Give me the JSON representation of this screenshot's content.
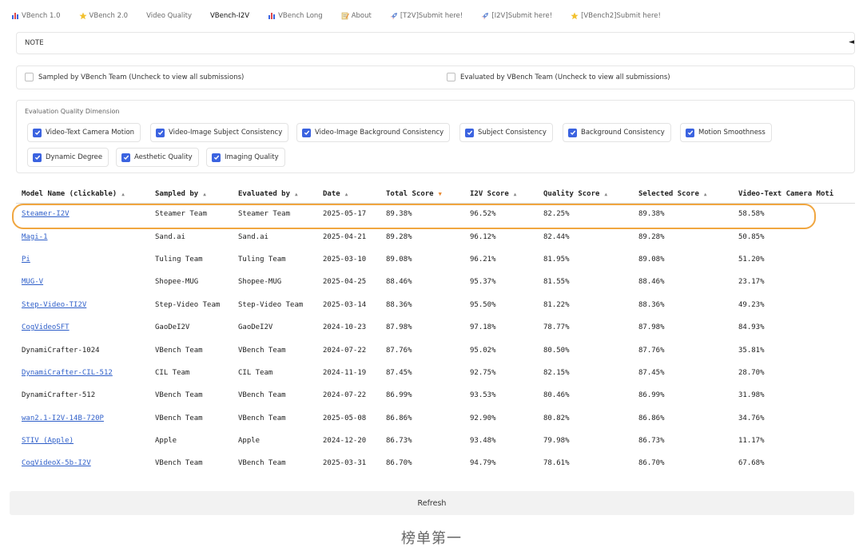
{
  "tabs": [
    {
      "icon": "bar-chart-icon",
      "label": "VBench 1.0"
    },
    {
      "icon": "star-icon",
      "label": "VBench 2.0"
    },
    {
      "icon": "",
      "label": "Video Quality"
    },
    {
      "icon": "",
      "label": "VBench-I2V"
    },
    {
      "icon": "bar-chart-icon",
      "label": "VBench Long"
    },
    {
      "icon": "memo-icon",
      "label": "About"
    },
    {
      "icon": "rocket-icon",
      "label": "[T2V]Submit here!"
    },
    {
      "icon": "rocket-icon",
      "label": "[I2V]Submit here!"
    },
    {
      "icon": "star-icon",
      "label": "[VBench2]Submit here!"
    }
  ],
  "note": {
    "label": "NOTE",
    "toggle": "◄"
  },
  "filters": {
    "sampled": "Sampled by VBench Team (Uncheck to view all submissions)",
    "evaluated": "Evaluated by VBench Team (Uncheck to view all submissions)"
  },
  "dimensions": {
    "label": "Evaluation Quality Dimension",
    "items": [
      "Video-Text Camera Motion",
      "Video-Image Subject Consistency",
      "Video-Image Background Consistency",
      "Subject Consistency",
      "Background Consistency",
      "Motion Smoothness",
      "Dynamic Degree",
      "Aesthetic Quality",
      "Imaging Quality"
    ]
  },
  "table": {
    "headers": [
      "Model Name (clickable)",
      "Sampled by",
      "Evaluated by",
      "Date",
      "Total Score",
      "I2V Score",
      "Quality Score",
      "Selected Score",
      "Video-Text Camera Moti"
    ],
    "rows": [
      [
        "Steamer-I2V",
        "Steamer Team",
        "Steamer Team",
        "2025-05-17",
        "89.38%",
        "96.52%",
        "82.25%",
        "89.38%",
        "58.58%"
      ],
      [
        "Magi-1",
        "Sand.ai",
        "Sand.ai",
        "2025-04-21",
        "89.28%",
        "96.12%",
        "82.44%",
        "89.28%",
        "50.85%"
      ],
      [
        "Pi",
        "Tuling Team",
        "Tuling Team",
        "2025-03-10",
        "89.08%",
        "96.21%",
        "81.95%",
        "89.08%",
        "51.20%"
      ],
      [
        "MUG-V",
        "Shopee-MUG",
        "Shopee-MUG",
        "2025-04-25",
        "88.46%",
        "95.37%",
        "81.55%",
        "88.46%",
        "23.17%"
      ],
      [
        "Step-Video-TI2V",
        "Step-Video Team",
        "Step-Video Team",
        "2025-03-14",
        "88.36%",
        "95.50%",
        "81.22%",
        "88.36%",
        "49.23%"
      ],
      [
        "CogVideoSFT",
        "GaoDeI2V",
        "GaoDeI2V",
        "2024-10-23",
        "87.98%",
        "97.18%",
        "78.77%",
        "87.98%",
        "84.93%"
      ],
      [
        "DynamiCrafter-1024",
        "VBench Team",
        "VBench Team",
        "2024-07-22",
        "87.76%",
        "95.02%",
        "80.50%",
        "87.76%",
        "35.81%"
      ],
      [
        "DynamiCrafter-CIL-512",
        "CIL Team",
        "CIL Team",
        "2024-11-19",
        "87.45%",
        "92.75%",
        "82.15%",
        "87.45%",
        "28.70%"
      ],
      [
        "DynamiCrafter-512",
        "VBench Team",
        "VBench Team",
        "2024-07-22",
        "86.99%",
        "93.53%",
        "80.46%",
        "86.99%",
        "31.98%"
      ],
      [
        "wan2.1-I2V-14B-720P",
        "VBench Team",
        "VBench Team",
        "2025-05-08",
        "86.86%",
        "92.90%",
        "80.82%",
        "86.86%",
        "34.76%"
      ],
      [
        "STIV (Apple)",
        "Apple",
        "Apple",
        "2024-12-20",
        "86.73%",
        "93.48%",
        "79.98%",
        "86.73%",
        "11.17%"
      ],
      [
        "CogVideoX-5b-I2V",
        "VBench Team",
        "VBench Team",
        "2025-03-31",
        "86.70%",
        "94.79%",
        "78.61%",
        "86.70%",
        "67.68%"
      ]
    ],
    "links": [
      true,
      true,
      true,
      true,
      true,
      true,
      false,
      true,
      false,
      true,
      true,
      true
    ]
  },
  "refresh_label": "Refresh",
  "caption": "榜单第一",
  "colors": {
    "accent": "#3b63e0",
    "link": "#2f5fc9",
    "highlight": "#f0a640",
    "sort_active": "#e8872d"
  }
}
